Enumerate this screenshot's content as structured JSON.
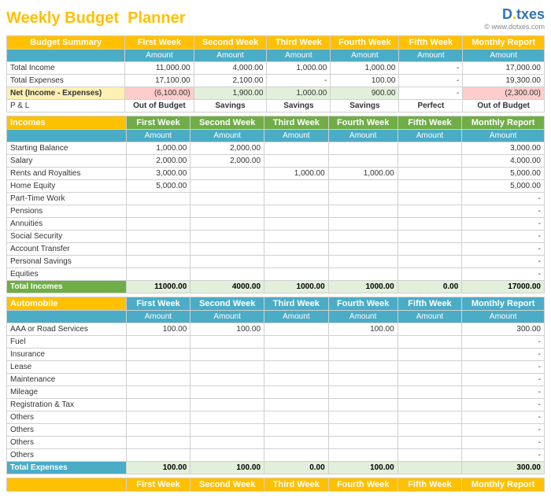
{
  "title": {
    "main": "Weekly Budget",
    "highlight": "Planner"
  },
  "logo": {
    "text1": "D",
    "text2": "txes",
    "dot": ".",
    "website": "© www.dotxes.com"
  },
  "weeks": [
    "First Week",
    "Second Week",
    "Third Week",
    "Fourth Week",
    "Fifth Week",
    "Monthly Report"
  ],
  "amount_label": "Amount",
  "budget_summary": {
    "section_label": "Budget Summary",
    "rows": [
      {
        "label": "Total Income",
        "values": [
          "11,000.00",
          "4,000.00",
          "1,000.00",
          "1,000.00",
          "-",
          "17,000.00"
        ]
      },
      {
        "label": "Total Expenses",
        "values": [
          "17,100.00",
          "2,100.00",
          "-",
          "100.00",
          "-",
          "19,300.00"
        ]
      },
      {
        "label": "Net (Income - Expenses)",
        "values": [
          "(6,100.00)",
          "1,900.00",
          "1,000.00",
          "900.00",
          "-",
          "(2,300.00)"
        ],
        "type": "net"
      },
      {
        "label": "P & L",
        "values": [
          "Out of Budget",
          "Savings",
          "Savings",
          "Savings",
          "Perfect",
          "Out of Budget"
        ],
        "type": "pl"
      }
    ]
  },
  "incomes": {
    "section_label": "Incomes",
    "rows": [
      {
        "label": "Starting Balance",
        "values": [
          "1,000.00",
          "2,000.00",
          "",
          "",
          "",
          "3,000.00"
        ]
      },
      {
        "label": "Salary",
        "values": [
          "2,000.00",
          "2,000.00",
          "",
          "",
          "",
          "4,000.00"
        ]
      },
      {
        "label": "Rents and Royalties",
        "values": [
          "3,000.00",
          "",
          "1,000.00",
          "1,000.00",
          "",
          "5,000.00"
        ]
      },
      {
        "label": "Home Equity",
        "values": [
          "5,000.00",
          "",
          "",
          "",
          "",
          "5,000.00"
        ]
      },
      {
        "label": "Part-Time Work",
        "values": [
          "",
          "",
          "",
          "",
          "",
          "-"
        ]
      },
      {
        "label": "Pensions",
        "values": [
          "",
          "",
          "",
          "",
          "",
          "-"
        ]
      },
      {
        "label": "Annuities",
        "values": [
          "",
          "",
          "",
          "",
          "",
          "-"
        ]
      },
      {
        "label": "Social Security",
        "values": [
          "",
          "",
          "",
          "",
          "",
          "-"
        ]
      },
      {
        "label": "Account Transfer",
        "values": [
          "",
          "",
          "",
          "",
          "",
          "-"
        ]
      },
      {
        "label": "Personal Savings",
        "values": [
          "",
          "",
          "",
          "",
          "",
          "-"
        ]
      },
      {
        "label": "Equities",
        "values": [
          "",
          "",
          "",
          "",
          "",
          "-"
        ]
      }
    ],
    "total_label": "Total Incomes",
    "total_values": [
      "11000.00",
      "4000.00",
      "1000.00",
      "1000.00",
      "0.00",
      "17000.00"
    ]
  },
  "automobile": {
    "section_label": "Automobile",
    "rows": [
      {
        "label": "AAA or Road Services",
        "values": [
          "100.00",
          "100.00",
          "",
          "100.00",
          "",
          "300.00"
        ]
      },
      {
        "label": "Fuel",
        "values": [
          "",
          "",
          "",
          "",
          "",
          "-"
        ]
      },
      {
        "label": "Insurance",
        "values": [
          "",
          "",
          "",
          "",
          "",
          "-"
        ]
      },
      {
        "label": "Lease",
        "values": [
          "",
          "",
          "",
          "",
          "",
          "-"
        ]
      },
      {
        "label": "Maintenance",
        "values": [
          "",
          "",
          "",
          "",
          "",
          "-"
        ]
      },
      {
        "label": "Mileage",
        "values": [
          "",
          "",
          "",
          "",
          "",
          "-"
        ]
      },
      {
        "label": "Registration & Tax",
        "values": [
          "",
          "",
          "",
          "",
          "",
          "-"
        ]
      },
      {
        "label": "Others",
        "values": [
          "",
          "",
          "",
          "",
          "",
          "-"
        ]
      },
      {
        "label": "Others",
        "values": [
          "",
          "",
          "",
          "",
          "",
          "-"
        ]
      },
      {
        "label": "Others",
        "values": [
          "",
          "",
          "",
          "",
          "",
          "-"
        ]
      },
      {
        "label": "Others",
        "values": [
          "",
          "",
          "",
          "",
          "",
          "-"
        ]
      }
    ],
    "total_label": "Total Expenses",
    "total_values": [
      "100.00",
      "100.00",
      "0.00",
      "100.00",
      "",
      "300.00"
    ]
  },
  "next_section_weeks": [
    "First Week",
    "Second Week",
    "Third Week",
    "Fourth Week",
    "Fifth Week",
    "Monthly Report"
  ]
}
